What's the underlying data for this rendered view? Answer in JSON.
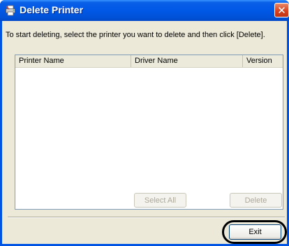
{
  "window": {
    "title": "Delete Printer",
    "close_glyph": "✕",
    "icon": "printer-icon"
  },
  "instruction": "To start deleting, select the printer you want to delete and then click [Delete].",
  "list": {
    "columns": [
      "Printer Name",
      "Driver Name",
      "Version"
    ],
    "rows": []
  },
  "buttons": {
    "select_all": "Select All",
    "delete": "Delete",
    "exit": "Exit"
  },
  "colors": {
    "titlebar": "#0054e3",
    "dialog_face": "#ece9d8",
    "close_button": "#d8431f",
    "highlight_oval": "#000000"
  }
}
